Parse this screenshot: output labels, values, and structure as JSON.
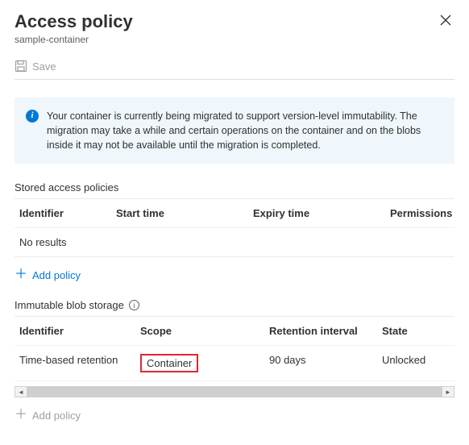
{
  "header": {
    "title": "Access policy",
    "subtitle": "sample-container"
  },
  "toolbar": {
    "save_label": "Save"
  },
  "info": {
    "message": "Your container is currently being migrated to support version-level immutability. The migration may take a while and certain operations on the container and on the blobs inside it may not be available until the migration is completed."
  },
  "stored_policies": {
    "section_title": "Stored access policies",
    "columns": {
      "identifier": "Identifier",
      "start": "Start time",
      "expiry": "Expiry time",
      "permissions": "Permissions"
    },
    "no_results": "No results",
    "add_label": "Add policy"
  },
  "immutable": {
    "section_title": "Immutable blob storage",
    "columns": {
      "identifier": "Identifier",
      "scope": "Scope",
      "retention": "Retention interval",
      "state": "State"
    },
    "rows": [
      {
        "identifier": "Time-based retention",
        "scope": "Container",
        "retention": "90 days",
        "state": "Unlocked"
      }
    ],
    "add_label": "Add policy"
  }
}
